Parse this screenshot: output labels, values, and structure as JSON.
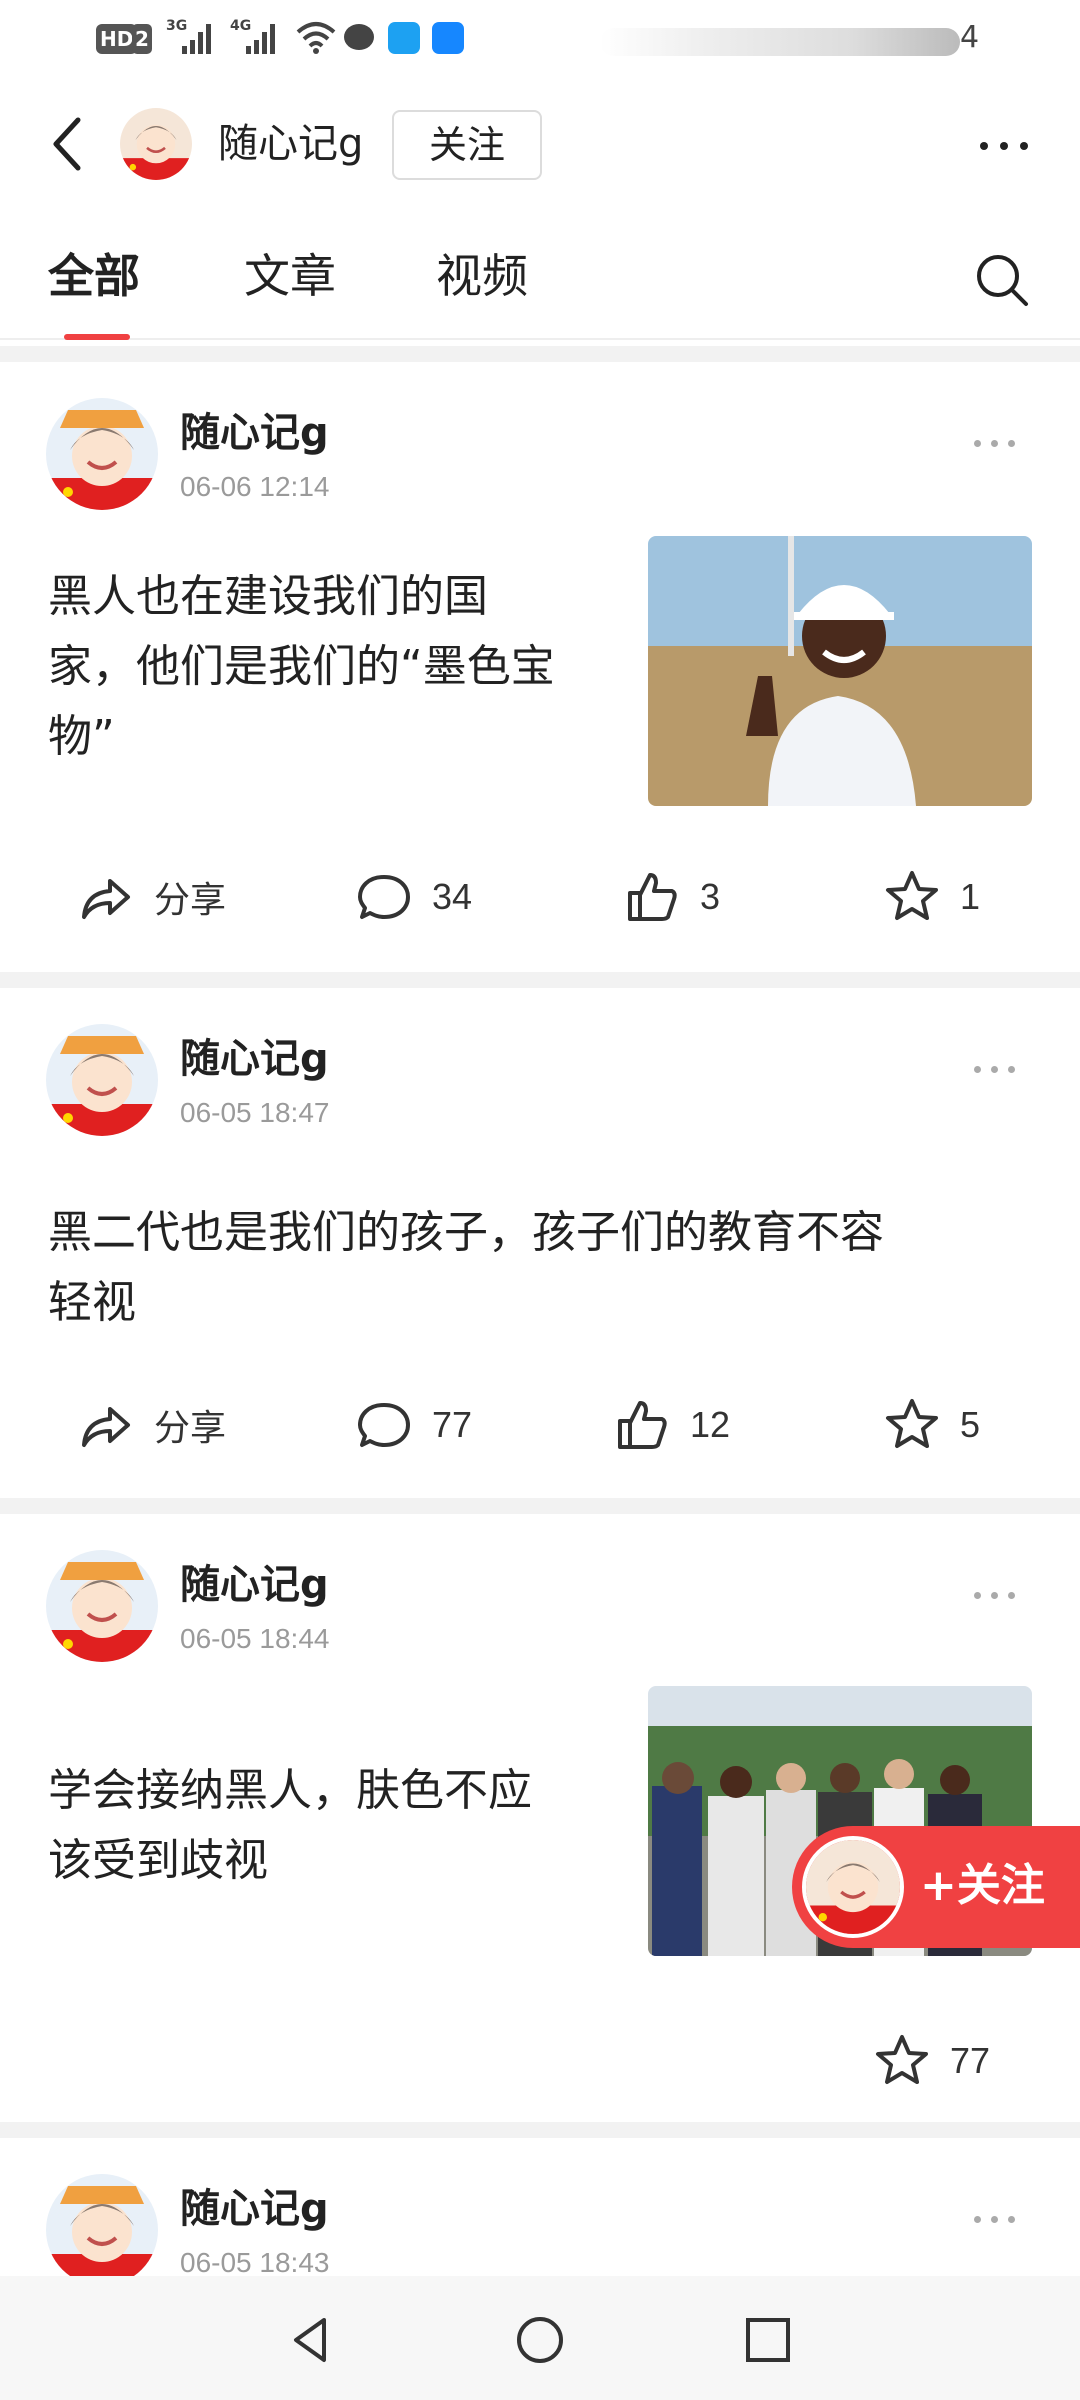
{
  "status_bar": {
    "hd_label": "HD",
    "hd_sim": "2",
    "net1": "3G",
    "net2": "4G",
    "battery_text": "4"
  },
  "header": {
    "author_name": "随心记g",
    "follow_label": "关注"
  },
  "tabs": [
    {
      "label": "全部",
      "active": true
    },
    {
      "label": "文章",
      "active": false
    },
    {
      "label": "视频",
      "active": false
    }
  ],
  "posts": [
    {
      "author": "随心记g",
      "time": "06-06 12:14",
      "text_lines": [
        "黑人也在建设我们的国",
        "家，他们是我们的“墨色宝",
        "物”"
      ],
      "has_image": true,
      "image_icon": "man-in-hard-hat-photo",
      "share_label": "分享",
      "comments": "34",
      "likes": "3",
      "favorites": "1"
    },
    {
      "author": "随心记g",
      "time": "06-05 18:47",
      "text_lines": [
        "黑二代也是我们的孩子，孩子们的教育不容",
        "轻视"
      ],
      "has_image": false,
      "share_label": "分享",
      "comments": "77",
      "likes": "12",
      "favorites": "5"
    },
    {
      "author": "随心记g",
      "time": "06-05 18:44",
      "text_lines": [
        "学会接纳黑人，肤色不应",
        "该受到歧视"
      ],
      "has_image": true,
      "image_icon": "group-of-people-photo",
      "favorites": "77"
    },
    {
      "author": "随心记g",
      "time": "06-05 18:43"
    }
  ],
  "floating_follow": {
    "label": "+关注"
  },
  "colors": {
    "accent": "#f04142",
    "muted": "#9a9a9a",
    "divider": "#f2f2f2"
  },
  "icons": [
    "back-arrow-icon",
    "more-icon",
    "search-icon",
    "share-icon",
    "comment-icon",
    "like-icon",
    "favorite-icon",
    "nav-back-icon",
    "nav-home-icon",
    "nav-recents-icon"
  ]
}
